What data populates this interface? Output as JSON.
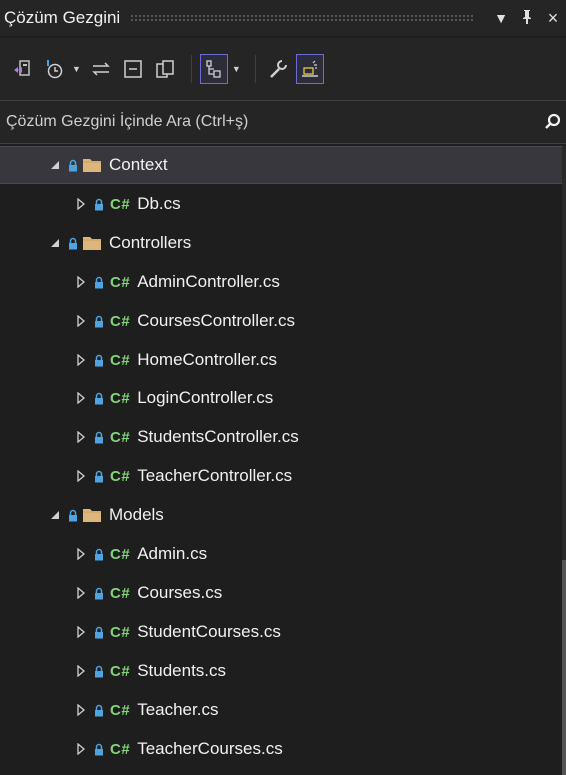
{
  "window": {
    "title": "Çözüm Gezgini",
    "controls": {
      "menu": "▼",
      "pin": "⭲",
      "close": "×"
    }
  },
  "toolbar": {
    "buttons": [
      {
        "name": "vs-sync-icon"
      },
      {
        "name": "history-icon"
      },
      {
        "name": "switch-views-icon"
      },
      {
        "name": "collapse-all-icon"
      },
      {
        "name": "copy-icon"
      },
      {
        "name": "show-all-files-icon",
        "active": true
      },
      {
        "name": "properties-icon"
      },
      {
        "name": "preview-icon",
        "active": true
      }
    ]
  },
  "search": {
    "placeholder": "Çözüm Gezgini İçinde Ara (Ctrl+ş)"
  },
  "colors": {
    "background": "#1e1e1e",
    "panel": "#252526",
    "selected_row": "#37373d",
    "folder": "#dcb67a",
    "csharp": "#83d37a",
    "lock": "#4ea3e0"
  },
  "tree": {
    "items": [
      {
        "label": "Context",
        "type": "folder",
        "expanded": true,
        "selected": true
      },
      {
        "label": "Db.cs",
        "type": "cs",
        "cs_label": "C#"
      },
      {
        "label": "Controllers",
        "type": "folder",
        "expanded": true
      },
      {
        "label": "AdminController.cs",
        "type": "cs",
        "cs_label": "C#"
      },
      {
        "label": "CoursesController.cs",
        "type": "cs",
        "cs_label": "C#"
      },
      {
        "label": "HomeController.cs",
        "type": "cs",
        "cs_label": "C#"
      },
      {
        "label": "LoginController.cs",
        "type": "cs",
        "cs_label": "C#"
      },
      {
        "label": "StudentsController.cs",
        "type": "cs",
        "cs_label": "C#"
      },
      {
        "label": "TeacherController.cs",
        "type": "cs",
        "cs_label": "C#"
      },
      {
        "label": "Models",
        "type": "folder",
        "expanded": true
      },
      {
        "label": "Admin.cs",
        "type": "cs",
        "cs_label": "C#"
      },
      {
        "label": "Courses.cs",
        "type": "cs",
        "cs_label": "C#"
      },
      {
        "label": "StudentCourses.cs",
        "type": "cs",
        "cs_label": "C#"
      },
      {
        "label": "Students.cs",
        "type": "cs",
        "cs_label": "C#"
      },
      {
        "label": "Teacher.cs",
        "type": "cs",
        "cs_label": "C#"
      },
      {
        "label": "TeacherCourses.cs",
        "type": "cs",
        "cs_label": "C#"
      }
    ]
  }
}
